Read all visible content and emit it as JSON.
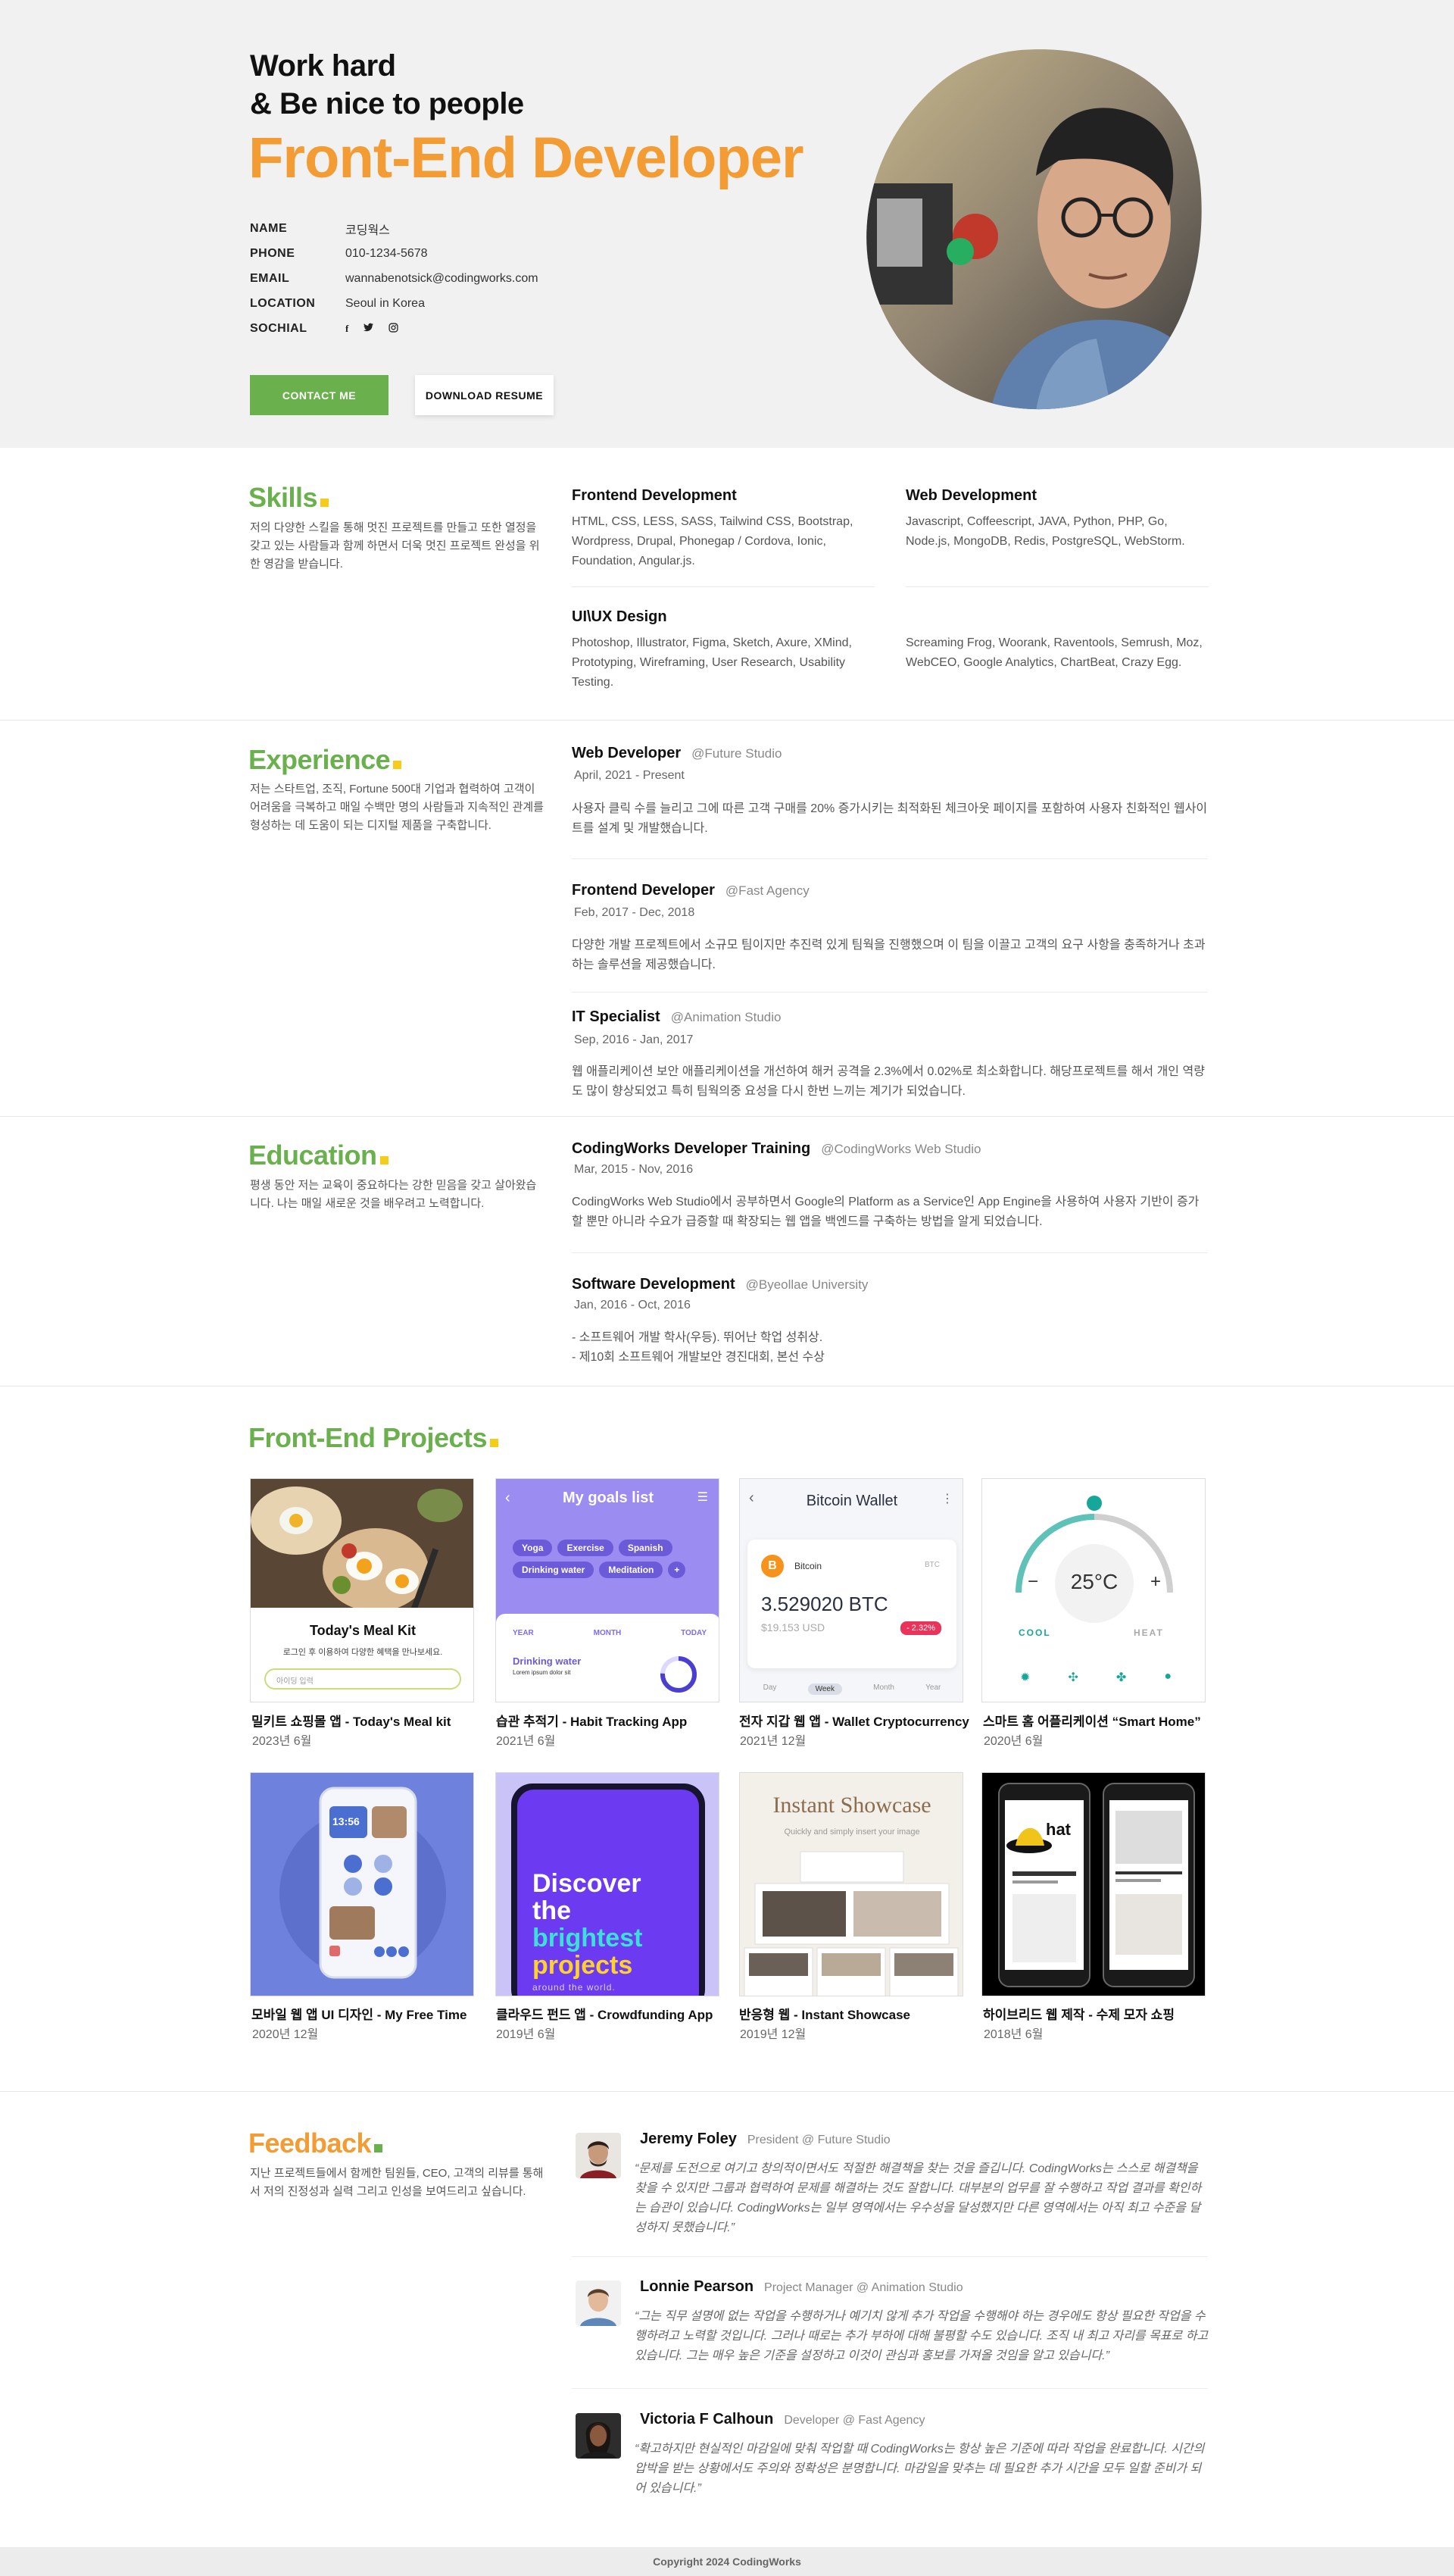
{
  "hero": {
    "tagline_1": "Work hard",
    "tagline_2": "& Be nice to people",
    "title": "Front-End Developer",
    "info": [
      {
        "label": "NAME",
        "value": "코딩웍스"
      },
      {
        "label": "PHONE",
        "value": "010-1234-5678"
      },
      {
        "label": "EMAIL",
        "value": "wannabenotsick@codingworks.com"
      },
      {
        "label": "LOCATION",
        "value": "Seoul in Korea"
      },
      {
        "label": "SOCHIAL",
        "value": ""
      }
    ],
    "social_icons": [
      "facebook-icon",
      "twitter-icon",
      "instagram-icon"
    ],
    "social_glyphs": [
      "f",
      "🐦",
      "◎"
    ],
    "contact_label": "CONTACT ME",
    "download_label": "DOWNLOAD RESUME"
  },
  "skills": {
    "heading": "Skills",
    "desc": "저의 다양한 스킬을 통해 멋진 프로젝트를 만들고 또한 열정을 갖고 있는 사람들과 함께 하면서 더욱 멋진 프로젝트 완성을 위한 영감을 받습니다.",
    "items": [
      {
        "title": "Frontend Development",
        "text": "HTML, CSS, LESS, SASS, Tailwind CSS, Bootstrap, Wordpress, Drupal, Phonegap / Cordova, Ionic, Foundation, Angular.js."
      },
      {
        "title": "Web Development",
        "text": "Javascript, Coffeescript, JAVA, Python, PHP, Go, Node.js, MongoDB, Redis, PostgreSQL, WebStorm."
      },
      {
        "title": "UI\\UX Design",
        "text": "Photoshop, Illustrator, Figma, Sketch, Axure, XMind, Prototyping, Wireframing, User Research, Usability Testing."
      },
      {
        "title": "",
        "text": "Screaming Frog, Woorank, Raventools, Semrush, Moz, WebCEO, Google Analytics, ChartBeat, Crazy Egg."
      }
    ]
  },
  "experience": {
    "heading": "Experience",
    "desc": "저는 스타트업, 조직, Fortune 500대 기업과 협력하여 고객이 어려움을 극복하고 매일 수백만 명의 사람들과 지속적인 관계를 형성하는 데 도움이 되는 디지털 제품을 구축합니다.",
    "items": [
      {
        "title": "Web Developer",
        "org": "@Future Studio",
        "date": "April, 2021 - Present",
        "desc": "사용자 클릭 수를 늘리고 그에 따른 고객 구매를 20% 증가시키는 최적화된 체크아웃 페이지를 포함하여 사용자 친화적인 웹사이트를 설계 및 개발했습니다."
      },
      {
        "title": "Frontend Developer",
        "org": "@Fast Agency",
        "date": "Feb, 2017 - Dec, 2018",
        "desc": "다양한 개발 프로젝트에서 소규모 팀이지만 추진력 있게 팀웍을 진행했으며 이 팀을 이끌고 고객의 요구 사항을 충족하거나 초과하는 솔루션을 제공했습니다."
      },
      {
        "title": "IT Specialist",
        "org": "@Animation Studio",
        "date": "Sep, 2016 - Jan, 2017",
        "desc": "웹 애플리케이션 보안 애플리케이션을 개선하여 해커 공격을 2.3%에서 0.02%로 최소화합니다. 해당프로젝트를 해서 개인 역량도 많이 향상되었고 특히 팀웍의중 요성을 다시 한번 느끼는 계기가 되었습니다."
      }
    ]
  },
  "education": {
    "heading": "Education",
    "desc": "평생 동안 저는 교육이 중요하다는 강한 믿음을 갖고 살아왔습니다. 나는 매일 새로운 것을 배우려고 노력합니다.",
    "items": [
      {
        "title": "CodingWorks Developer Training",
        "org": "@CodingWorks Web Studio",
        "date": "Mar, 2015 - Nov, 2016",
        "desc": "CodingWorks Web Studio에서 공부하면서 Google의 Platform as a Service인 App Engine을 사용하여 사용자 기반이 증가할 뿐만 아니라 수요가 급증할 때 확장되는 웹 앱을 백엔드를 구축하는 방법을 알게 되었습니다."
      },
      {
        "title": "Software Development",
        "org": "@Byeollae University",
        "date": "Jan, 2016 - Oct, 2016",
        "desc_1": "- 소프트웨어 개발 학사(우등). 뛰어난 학업 성취상.",
        "desc_2": "- 제10회 소프트웨어 개발보안 경진대회, 본선 수상"
      }
    ]
  },
  "projects": {
    "heading": "Front-End Projects",
    "items": [
      {
        "title": "밀키트 쇼핑몰 앱 - Today's Meal kit",
        "date": "2023년 6월"
      },
      {
        "title": "습관 추적기 - Habit Tracking App",
        "date": "2021년 6월"
      },
      {
        "title": "전자 지갑 웹 앱 - Wallet Cryptocurrency",
        "date": "2021년 12월"
      },
      {
        "title": "스마트 홈 어플리케이션 “Smart Home”",
        "date": "2020년 6월"
      },
      {
        "title": "모바일 웹 앱 UI 디자인 - My Free Time",
        "date": "2020년 12월"
      },
      {
        "title": "클라우드 펀드 앱 - Crowdfunding App",
        "date": "2019년 6월"
      },
      {
        "title": "반응형 웹 - Instant Showcase",
        "date": "2019년 12월"
      },
      {
        "title": "하이브리드 웹 제작 - 수제 모자 쇼핑",
        "date": "2018년 6월"
      }
    ],
    "thumbs": {
      "meal_title": "Today's Meal Kit",
      "meal_sub": "로그인 후 이용하여 다양한 혜택을 만나보세요.",
      "meal_input": "아이딩 입력",
      "goals_title": "My goals list",
      "goals_tags": [
        "Yoga",
        "Exercise",
        "Spanish",
        "Drinking water",
        "Meditation",
        "+"
      ],
      "goals_tabs": [
        "YEAR",
        "MONTH",
        "TODAY"
      ],
      "goals_item": "Drinking water",
      "goals_lorem": "Lorem ipsum dolor sit",
      "wallet_title": "Bitcoin Wallet",
      "wallet_coin": "Bitcoin",
      "wallet_code": "BTC",
      "wallet_amount": "3.529020 BTC",
      "wallet_usd": "$19.153 USD",
      "wallet_change": "- 2.32%",
      "wallet_periods": [
        "Day",
        "Week",
        "Month",
        "Year"
      ],
      "home_temp": "25°C",
      "home_cool": "COOL",
      "home_heat": "HEAT",
      "home_minus": "−",
      "home_plus": "+",
      "free_time": "13:56",
      "discover_lines": [
        "Discover",
        "the",
        "brightest",
        "projects"
      ],
      "discover_sub": "around the world.",
      "showcase_title": "Instant Showcase",
      "showcase_sub": "Quickly and simply insert your image",
      "hat_word": "hat"
    }
  },
  "feedback": {
    "heading": "Feedback",
    "desc": "지난 프로젝트들에서 함께한 팀원들, CEO, 고객의 리뷰를 통해서 저의 진정성과 실력 그리고 인성을 보여드리고 싶습니다.",
    "items": [
      {
        "name": "Jeremy Foley",
        "role": "President @ Future Studio",
        "quote": "“문제를 도전으로 여기고 창의적이면서도 적절한 해결책을 찾는 것을 즐깁니다. CodingWorks는 스스로 해결책을 찾을 수 있지만 그룹과 협력하여 문제를 해결하는 것도 잘합니다. 대부분의 업무를 잘 수행하고 작업 결과를 확인하는 습관이 있습니다. CodingWorks는 일부 영역에서는 우수성을 달성했지만 다른 영역에서는 아직 최고 수준을 달성하지 못했습니다.”"
      },
      {
        "name": "Lonnie Pearson",
        "role": "Project Manager @ Animation Studio",
        "quote": "“그는 직무 설명에 없는 작업을 수행하거나 예기치 않게 추가 작업을 수행해야 하는 경우에도 항상 필요한 작업을 수행하려고 노력할 것입니다. 그러나 때로는 추가 부하에 대해 불평할 수도 있습니다. 조직 내 최고 자리를 목표로 하고 있습니다. 그는 매우 높은 기준을 설정하고 이것이 관심과 홍보를 가져올 것임을 알고 있습니다.”"
      },
      {
        "name": "Victoria F Calhoun",
        "role": "Developer @ Fast Agency",
        "quote": "“확고하지만 현실적인 마감일에 맞춰 작업할 때 CodingWorks는 항상 높은 기준에 따라 작업을 완료합니다. 시간의 압박을 받는 상황에서도 주의와 정확성은 분명합니다. 마감일을 맞추는 데 필요한 추가 시간을 모두 일할 준비가 되어 있습니다.”"
      }
    ]
  },
  "footer": {
    "text": "Copyright 2024 CodingWorks"
  },
  "colors": {
    "green": "#6ab04c",
    "orange": "#f39c34",
    "yellow": "#f5cc1a",
    "hero_bg": "#f1f1f1"
  }
}
